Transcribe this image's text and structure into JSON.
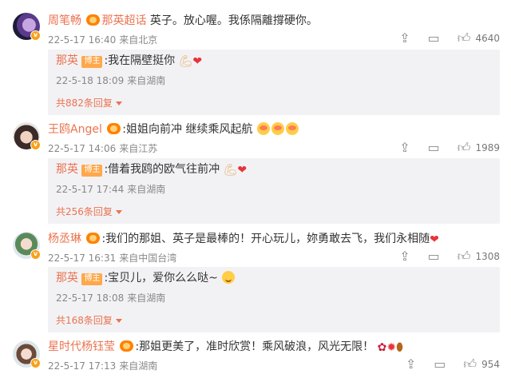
{
  "comments": [
    {
      "user": "周笔畅",
      "badge": "那英超话",
      "text": "英子。放心喔。我係隔離撐硬你。",
      "date": "22-5-17 16:40",
      "location": "来自北京",
      "likes": "4640",
      "reply": {
        "user": "那英",
        "tag": "博主",
        "text": ":我在隔壁挺你",
        "date": "22-5-18 18:09",
        "location": "来自湖南",
        "count": "共882条回复"
      }
    },
    {
      "user": "王鸥Angel",
      "text": ":姐姐向前冲 继续乘风起航",
      "date": "22-5-17 14:06",
      "location": "来自江苏",
      "likes": "1989",
      "reply": {
        "user": "那英",
        "tag": "博主",
        "text": ":借着我鸥的欧气往前冲",
        "date": "22-5-17 17:44",
        "location": "来自湖南",
        "count": "共256条回复"
      }
    },
    {
      "user": "杨丞琳",
      "text": ":我们的那姐、英子是最棒的！开心玩儿，妳勇敢去飞，我们永相随",
      "date": "22-5-17 16:31",
      "location": "来自中国台湾",
      "likes": "1308",
      "reply": {
        "user": "那英",
        "tag": "博主",
        "text": ":宝贝儿，爱你么么哒~",
        "date": "22-5-17 18:08",
        "location": "来自湖南",
        "count": "共168条回复"
      }
    },
    {
      "user": "星时代杨钰莹",
      "text": ":那姐更美了，准时欣赏！乘风破浪，风光无限！",
      "date": "22-5-17 17:13",
      "location": "来自湖南",
      "likes": "954"
    }
  ],
  "icons": {
    "share": "share-icon",
    "comment": "comment-icon",
    "like": "thumbs-up-icon",
    "verified": "verified-badge-icon",
    "expand": "caret-down-icon"
  },
  "colors": {
    "username": "#eb7350",
    "meta": "#888888",
    "reply_bg": "#f2f2f5",
    "verified": "#f7a21b"
  }
}
